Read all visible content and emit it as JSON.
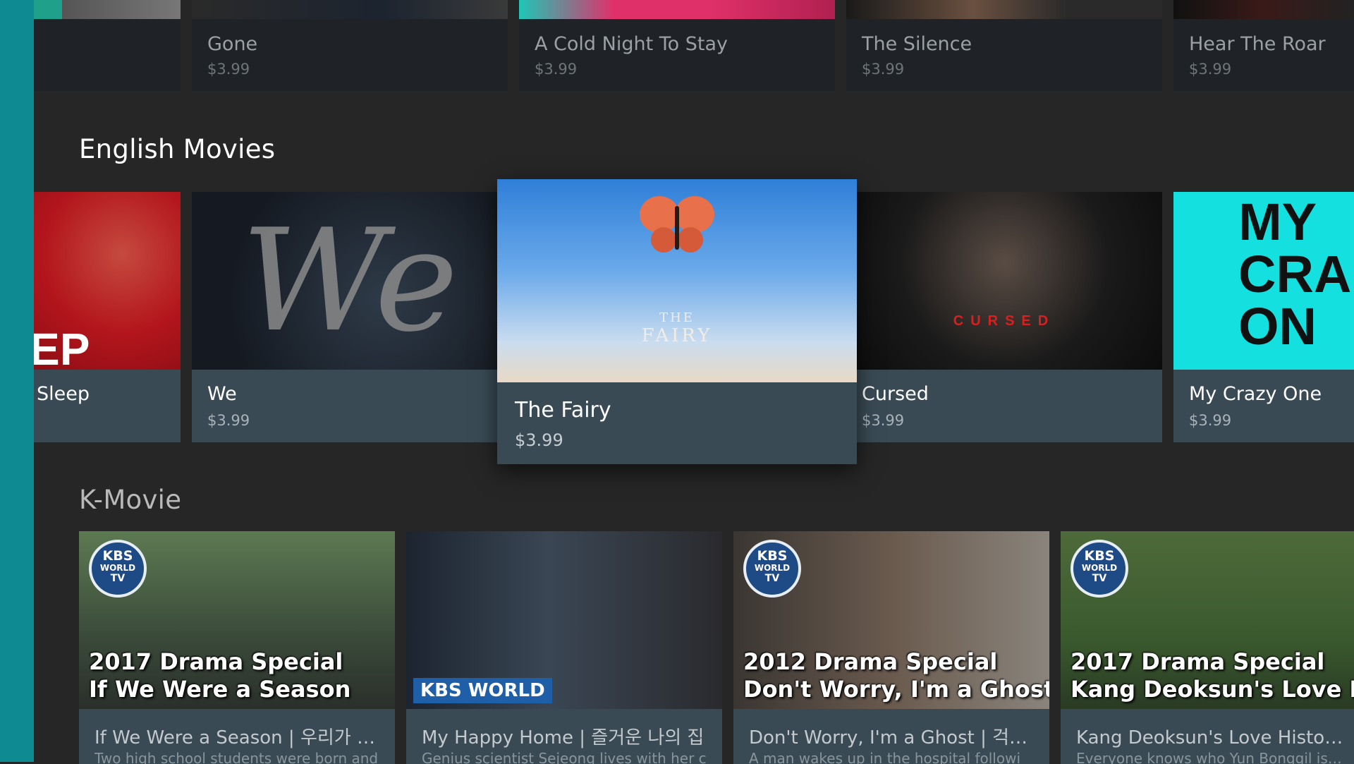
{
  "top_row": {
    "cards": [
      {
        "title": "",
        "price": ""
      },
      {
        "title": "Gone",
        "price": "$3.99"
      },
      {
        "title": "A Cold Night To Stay",
        "price": "$3.99"
      },
      {
        "title": "The Silence",
        "price": "$3.99"
      },
      {
        "title": "Hear The Roar",
        "price": "$3.99"
      }
    ]
  },
  "english_movies": {
    "title": "English Movies",
    "cards": [
      {
        "title": "Sleep",
        "price": "",
        "poster_text": "EP"
      },
      {
        "title": "We",
        "price": "$3.99",
        "poster_text": "We"
      },
      {
        "title": "The Fairy",
        "price": "$3.99",
        "poster_text_1": "THE",
        "poster_text_2": "FAIRY",
        "focused": true
      },
      {
        "title": "Cursed",
        "price": "$3.99",
        "poster_text": "CURSED"
      },
      {
        "title": "My Crazy One",
        "price": "$3.99",
        "poster_text": "MY CRA ON"
      }
    ]
  },
  "k_movie": {
    "title": "K-Movie",
    "cards": [
      {
        "caption_1": "2017 Drama Special",
        "caption_2": "If We Were a Season",
        "logo_1": "KBS",
        "logo_2": "WORLD",
        "logo_3": "TV",
        "title": "If We Were a Season | 우리가 계절이 바뀌는 이유",
        "desc": "Two high school students were born and"
      },
      {
        "banner": "KBS WORLD",
        "title": "My Happy Home | 즐거운 나의 집",
        "desc": "Genius scientist Sejeong lives with her c"
      },
      {
        "caption_1": "2012 Drama Special",
        "caption_2": "Don't Worry, I'm a Ghost",
        "logo_1": "KBS",
        "logo_2": "WORLD",
        "logo_3": "TV",
        "title": "Don't Worry, I'm a Ghost | 걱정마세요 귀신입니다",
        "desc": "A man wakes up in the hospital followi"
      },
      {
        "caption_1": "2017 Drama Special",
        "caption_2": "Kang Deoksun's Love History",
        "logo_1": "KBS",
        "logo_2": "WORLD",
        "logo_3": "TV",
        "title": "Kang Deoksun's Love History | 강덕순 애정 변천사",
        "desc": "Everyone knows who Yun Bonggil is but"
      }
    ]
  },
  "colors": {
    "sidebar": "#0e8a93",
    "background": "#262626",
    "card": "#3a4a55"
  }
}
